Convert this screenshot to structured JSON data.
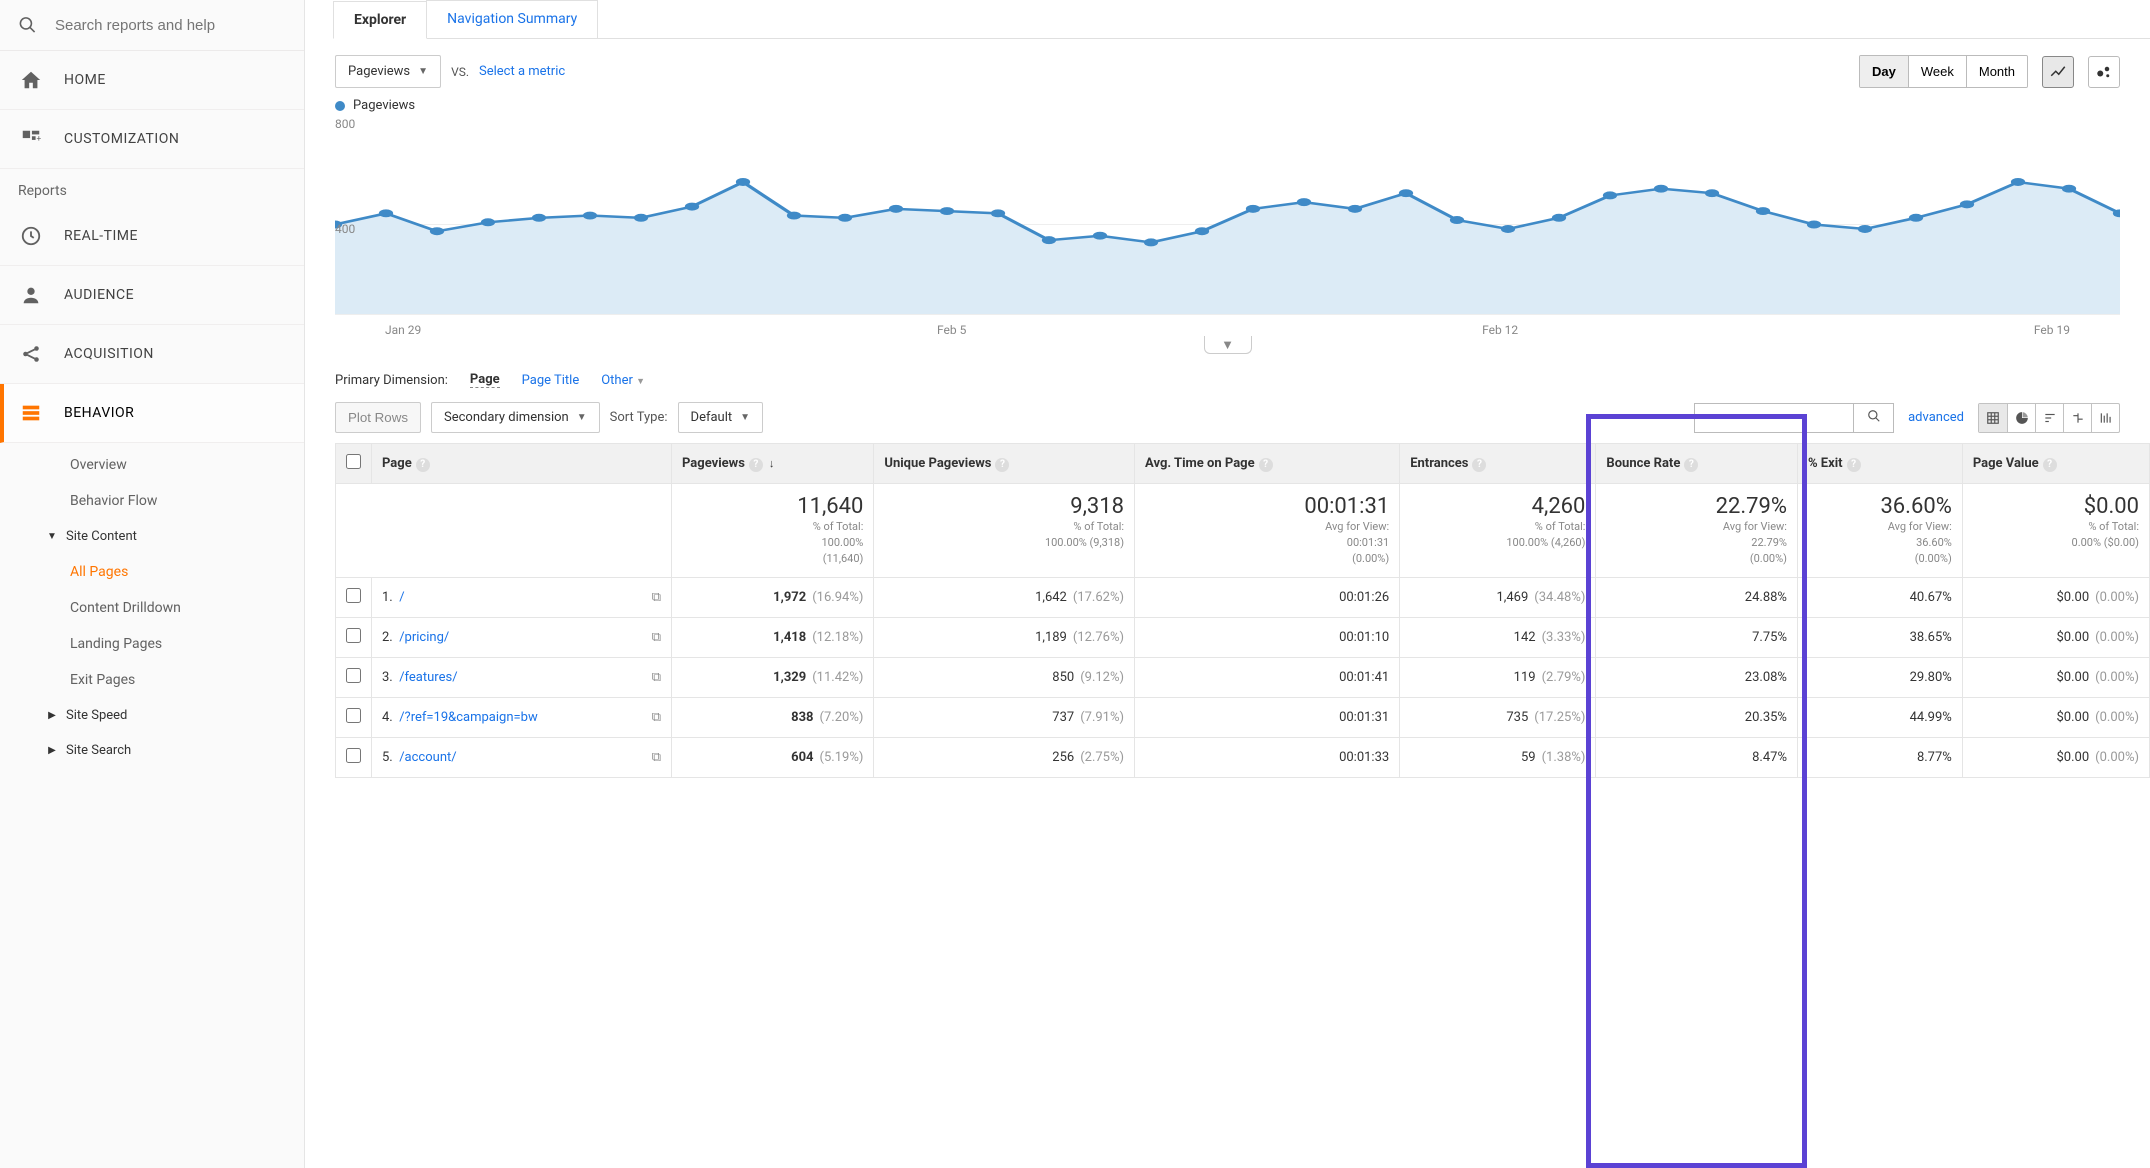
{
  "search": {
    "placeholder": "Search reports and help"
  },
  "nav": {
    "home": "HOME",
    "customization": "CUSTOMIZATION",
    "reports_label": "Reports",
    "realtime": "REAL-TIME",
    "audience": "AUDIENCE",
    "acquisition": "ACQUISITION",
    "behavior": "BEHAVIOR"
  },
  "subnav": {
    "overview": "Overview",
    "behavior_flow": "Behavior Flow",
    "site_content": "Site Content",
    "all_pages": "All Pages",
    "content_drilldown": "Content Drilldown",
    "landing_pages": "Landing Pages",
    "exit_pages": "Exit Pages",
    "site_speed": "Site Speed",
    "site_search": "Site Search"
  },
  "tabs": {
    "explorer": "Explorer",
    "navigation_summary": "Navigation Summary"
  },
  "toolbar": {
    "metric": "Pageviews",
    "vs": "VS.",
    "select_metric": "Select a metric",
    "day": "Day",
    "week": "Week",
    "month": "Month"
  },
  "chart_data": {
    "type": "line",
    "legend": "Pageviews",
    "ylabel_max": "800",
    "ylabel_mid": "400",
    "ylim": [
      0,
      800
    ],
    "x_ticks": [
      "Jan 29",
      "Feb 5",
      "Feb 12",
      "Feb 19"
    ],
    "values": [
      400,
      450,
      370,
      410,
      430,
      440,
      430,
      480,
      590,
      440,
      430,
      470,
      460,
      450,
      330,
      350,
      320,
      370,
      470,
      500,
      470,
      540,
      420,
      380,
      430,
      530,
      560,
      540,
      460,
      400,
      380,
      430,
      490,
      590,
      560,
      450
    ]
  },
  "dimension": {
    "label": "Primary Dimension:",
    "page": "Page",
    "page_title": "Page Title",
    "other": "Other"
  },
  "table_controls": {
    "plot_rows": "Plot Rows",
    "secondary_dimension": "Secondary dimension",
    "sort_type": "Sort Type:",
    "default": "Default",
    "advanced": "advanced"
  },
  "columns": {
    "page": "Page",
    "pageviews": "Pageviews",
    "unique_pageviews": "Unique Pageviews",
    "avg_time": "Avg. Time on Page",
    "entrances": "Entrances",
    "bounce_rate": "Bounce Rate",
    "pct_exit": "% Exit",
    "page_value": "Page Value"
  },
  "summary": {
    "pageviews": {
      "big": "11,640",
      "line1": "% of Total:",
      "line2": "100.00%",
      "line3": "(11,640)"
    },
    "unique": {
      "big": "9,318",
      "line1": "% of Total:",
      "line2": "100.00% (9,318)"
    },
    "avgtime": {
      "big": "00:01:31",
      "line1": "Avg for View:",
      "line2": "00:01:31",
      "line3": "(0.00%)"
    },
    "entrances": {
      "big": "4,260",
      "line1": "% of Total:",
      "line2": "100.00% (4,260)"
    },
    "bounce": {
      "big": "22.79%",
      "line1": "Avg for View:",
      "line2": "22.79%",
      "line3": "(0.00%)"
    },
    "exit": {
      "big": "36.60%",
      "line1": "Avg for View:",
      "line2": "36.60%",
      "line3": "(0.00%)"
    },
    "value": {
      "big": "$0.00",
      "line1": "% of Total:",
      "line2": "0.00% ($0.00)"
    }
  },
  "rows": [
    {
      "n": "1.",
      "page": "/",
      "pv": "1,972",
      "pv_pct": "(16.94%)",
      "upv": "1,642",
      "upv_pct": "(17.62%)",
      "time": "00:01:26",
      "ent": "1,469",
      "ent_pct": "(34.48%)",
      "br": "24.88%",
      "exit": "40.67%",
      "val": "$0.00",
      "val_pct": "(0.00%)"
    },
    {
      "n": "2.",
      "page": "/pricing/",
      "pv": "1,418",
      "pv_pct": "(12.18%)",
      "upv": "1,189",
      "upv_pct": "(12.76%)",
      "time": "00:01:10",
      "ent": "142",
      "ent_pct": "(3.33%)",
      "br": "7.75%",
      "exit": "38.65%",
      "val": "$0.00",
      "val_pct": "(0.00%)"
    },
    {
      "n": "3.",
      "page": "/features/",
      "pv": "1,329",
      "pv_pct": "(11.42%)",
      "upv": "850",
      "upv_pct": "(9.12%)",
      "time": "00:01:41",
      "ent": "119",
      "ent_pct": "(2.79%)",
      "br": "23.08%",
      "exit": "29.80%",
      "val": "$0.00",
      "val_pct": "(0.00%)"
    },
    {
      "n": "4.",
      "page": "/?ref=19&campaign=bw",
      "pv": "838",
      "pv_pct": "(7.20%)",
      "upv": "737",
      "upv_pct": "(7.91%)",
      "time": "00:01:31",
      "ent": "735",
      "ent_pct": "(17.25%)",
      "br": "20.35%",
      "exit": "44.99%",
      "val": "$0.00",
      "val_pct": "(0.00%)"
    },
    {
      "n": "5.",
      "page": "/account/",
      "pv": "604",
      "pv_pct": "(5.19%)",
      "upv": "256",
      "upv_pct": "(2.75%)",
      "time": "00:01:33",
      "ent": "59",
      "ent_pct": "(1.38%)",
      "br": "8.47%",
      "exit": "8.77%",
      "val": "$0.00",
      "val_pct": "(0.00%)"
    }
  ]
}
